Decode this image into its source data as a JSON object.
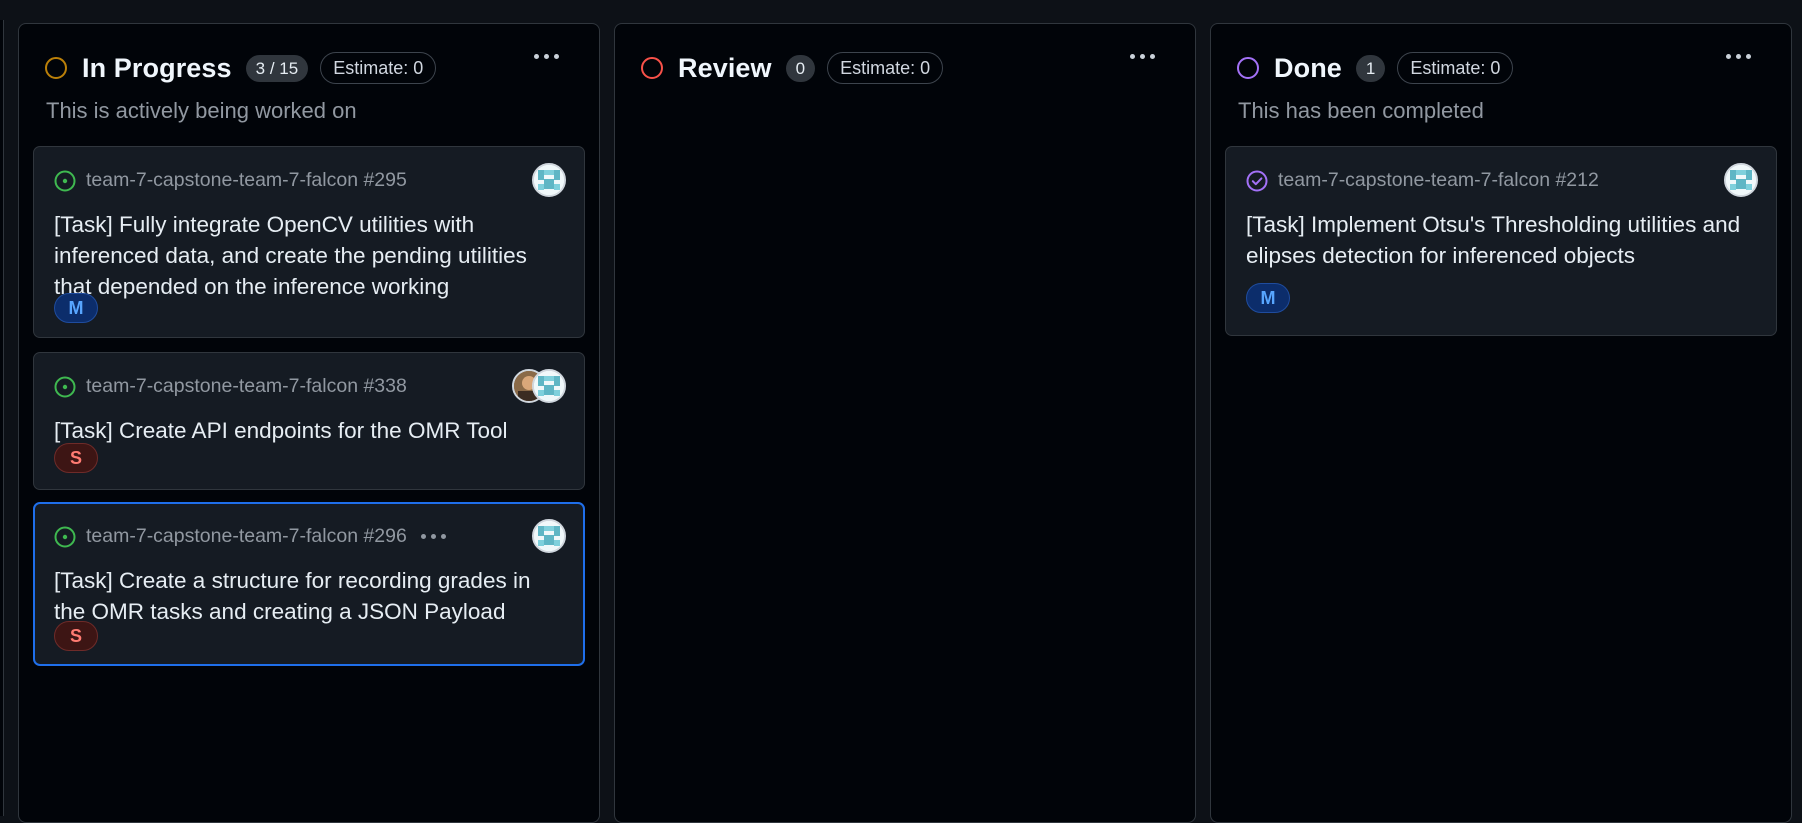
{
  "colors": {
    "in_progress_ring": "#bb8009",
    "review_ring": "#f85149",
    "done_ring": "#a371f7",
    "open_issue": "#3fb950",
    "closed_issue": "#a371f7",
    "selected_border": "#1f6feb"
  },
  "columns": [
    {
      "title": "In Progress",
      "count": "3 / 15",
      "estimate": "Estimate: 0",
      "description": "This is actively being worked on",
      "cards": [
        {
          "meta": "team-7-capstone-team-7-falcon #295",
          "title": "[Task] Fully integrate OpenCV utilities with inferenced data, and create the pending utilities that depended on the inference working",
          "size": "M",
          "status_icon": "issue-opened-icon"
        },
        {
          "meta": "team-7-capstone-team-7-falcon #338",
          "title": "[Task] Create API endpoints for the OMR Tool",
          "size": "S",
          "status_icon": "issue-opened-icon"
        },
        {
          "meta": "team-7-capstone-team-7-falcon #296",
          "title": "[Task] Create a structure for recording grades in the OMR tasks and creating a JSON Payload",
          "size": "S",
          "status_icon": "issue-opened-icon"
        }
      ]
    },
    {
      "title": "Review",
      "count": "0",
      "estimate": "Estimate: 0",
      "description": "",
      "cards": []
    },
    {
      "title": "Done",
      "count": "1",
      "estimate": "Estimate: 0",
      "description": "This has been completed",
      "cards": [
        {
          "meta": "team-7-capstone-team-7-falcon #212",
          "title": "[Task] Implement Otsu's Thresholding utilities and elipses detection for inferenced objects",
          "size": "M",
          "status_icon": "issue-closed-icon"
        }
      ]
    }
  ]
}
